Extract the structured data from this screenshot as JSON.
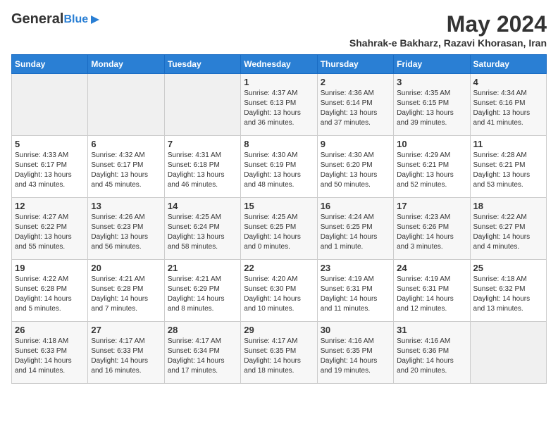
{
  "header": {
    "logo_general": "General",
    "logo_blue": "Blue",
    "month_year": "May 2024",
    "location": "Shahrak-e Bakharz, Razavi Khorasan, Iran"
  },
  "days_of_week": [
    "Sunday",
    "Monday",
    "Tuesday",
    "Wednesday",
    "Thursday",
    "Friday",
    "Saturday"
  ],
  "weeks": [
    [
      {
        "day": "",
        "sunrise": "",
        "sunset": "",
        "daylight": "",
        "empty": true
      },
      {
        "day": "",
        "sunrise": "",
        "sunset": "",
        "daylight": "",
        "empty": true
      },
      {
        "day": "",
        "sunrise": "",
        "sunset": "",
        "daylight": "",
        "empty": true
      },
      {
        "day": "1",
        "sunrise": "Sunrise: 4:37 AM",
        "sunset": "Sunset: 6:13 PM",
        "daylight": "Daylight: 13 hours and 36 minutes."
      },
      {
        "day": "2",
        "sunrise": "Sunrise: 4:36 AM",
        "sunset": "Sunset: 6:14 PM",
        "daylight": "Daylight: 13 hours and 37 minutes."
      },
      {
        "day": "3",
        "sunrise": "Sunrise: 4:35 AM",
        "sunset": "Sunset: 6:15 PM",
        "daylight": "Daylight: 13 hours and 39 minutes."
      },
      {
        "day": "4",
        "sunrise": "Sunrise: 4:34 AM",
        "sunset": "Sunset: 6:16 PM",
        "daylight": "Daylight: 13 hours and 41 minutes."
      }
    ],
    [
      {
        "day": "5",
        "sunrise": "Sunrise: 4:33 AM",
        "sunset": "Sunset: 6:17 PM",
        "daylight": "Daylight: 13 hours and 43 minutes."
      },
      {
        "day": "6",
        "sunrise": "Sunrise: 4:32 AM",
        "sunset": "Sunset: 6:17 PM",
        "daylight": "Daylight: 13 hours and 45 minutes."
      },
      {
        "day": "7",
        "sunrise": "Sunrise: 4:31 AM",
        "sunset": "Sunset: 6:18 PM",
        "daylight": "Daylight: 13 hours and 46 minutes."
      },
      {
        "day": "8",
        "sunrise": "Sunrise: 4:30 AM",
        "sunset": "Sunset: 6:19 PM",
        "daylight": "Daylight: 13 hours and 48 minutes."
      },
      {
        "day": "9",
        "sunrise": "Sunrise: 4:30 AM",
        "sunset": "Sunset: 6:20 PM",
        "daylight": "Daylight: 13 hours and 50 minutes."
      },
      {
        "day": "10",
        "sunrise": "Sunrise: 4:29 AM",
        "sunset": "Sunset: 6:21 PM",
        "daylight": "Daylight: 13 hours and 52 minutes."
      },
      {
        "day": "11",
        "sunrise": "Sunrise: 4:28 AM",
        "sunset": "Sunset: 6:21 PM",
        "daylight": "Daylight: 13 hours and 53 minutes."
      }
    ],
    [
      {
        "day": "12",
        "sunrise": "Sunrise: 4:27 AM",
        "sunset": "Sunset: 6:22 PM",
        "daylight": "Daylight: 13 hours and 55 minutes."
      },
      {
        "day": "13",
        "sunrise": "Sunrise: 4:26 AM",
        "sunset": "Sunset: 6:23 PM",
        "daylight": "Daylight: 13 hours and 56 minutes."
      },
      {
        "day": "14",
        "sunrise": "Sunrise: 4:25 AM",
        "sunset": "Sunset: 6:24 PM",
        "daylight": "Daylight: 13 hours and 58 minutes."
      },
      {
        "day": "15",
        "sunrise": "Sunrise: 4:25 AM",
        "sunset": "Sunset: 6:25 PM",
        "daylight": "Daylight: 14 hours and 0 minutes."
      },
      {
        "day": "16",
        "sunrise": "Sunrise: 4:24 AM",
        "sunset": "Sunset: 6:25 PM",
        "daylight": "Daylight: 14 hours and 1 minute."
      },
      {
        "day": "17",
        "sunrise": "Sunrise: 4:23 AM",
        "sunset": "Sunset: 6:26 PM",
        "daylight": "Daylight: 14 hours and 3 minutes."
      },
      {
        "day": "18",
        "sunrise": "Sunrise: 4:22 AM",
        "sunset": "Sunset: 6:27 PM",
        "daylight": "Daylight: 14 hours and 4 minutes."
      }
    ],
    [
      {
        "day": "19",
        "sunrise": "Sunrise: 4:22 AM",
        "sunset": "Sunset: 6:28 PM",
        "daylight": "Daylight: 14 hours and 5 minutes."
      },
      {
        "day": "20",
        "sunrise": "Sunrise: 4:21 AM",
        "sunset": "Sunset: 6:28 PM",
        "daylight": "Daylight: 14 hours and 7 minutes."
      },
      {
        "day": "21",
        "sunrise": "Sunrise: 4:21 AM",
        "sunset": "Sunset: 6:29 PM",
        "daylight": "Daylight: 14 hours and 8 minutes."
      },
      {
        "day": "22",
        "sunrise": "Sunrise: 4:20 AM",
        "sunset": "Sunset: 6:30 PM",
        "daylight": "Daylight: 14 hours and 10 minutes."
      },
      {
        "day": "23",
        "sunrise": "Sunrise: 4:19 AM",
        "sunset": "Sunset: 6:31 PM",
        "daylight": "Daylight: 14 hours and 11 minutes."
      },
      {
        "day": "24",
        "sunrise": "Sunrise: 4:19 AM",
        "sunset": "Sunset: 6:31 PM",
        "daylight": "Daylight: 14 hours and 12 minutes."
      },
      {
        "day": "25",
        "sunrise": "Sunrise: 4:18 AM",
        "sunset": "Sunset: 6:32 PM",
        "daylight": "Daylight: 14 hours and 13 minutes."
      }
    ],
    [
      {
        "day": "26",
        "sunrise": "Sunrise: 4:18 AM",
        "sunset": "Sunset: 6:33 PM",
        "daylight": "Daylight: 14 hours and 14 minutes."
      },
      {
        "day": "27",
        "sunrise": "Sunrise: 4:17 AM",
        "sunset": "Sunset: 6:33 PM",
        "daylight": "Daylight: 14 hours and 16 minutes."
      },
      {
        "day": "28",
        "sunrise": "Sunrise: 4:17 AM",
        "sunset": "Sunset: 6:34 PM",
        "daylight": "Daylight: 14 hours and 17 minutes."
      },
      {
        "day": "29",
        "sunrise": "Sunrise: 4:17 AM",
        "sunset": "Sunset: 6:35 PM",
        "daylight": "Daylight: 14 hours and 18 minutes."
      },
      {
        "day": "30",
        "sunrise": "Sunrise: 4:16 AM",
        "sunset": "Sunset: 6:35 PM",
        "daylight": "Daylight: 14 hours and 19 minutes."
      },
      {
        "day": "31",
        "sunrise": "Sunrise: 4:16 AM",
        "sunset": "Sunset: 6:36 PM",
        "daylight": "Daylight: 14 hours and 20 minutes."
      },
      {
        "day": "",
        "sunrise": "",
        "sunset": "",
        "daylight": "",
        "empty": true
      }
    ]
  ]
}
